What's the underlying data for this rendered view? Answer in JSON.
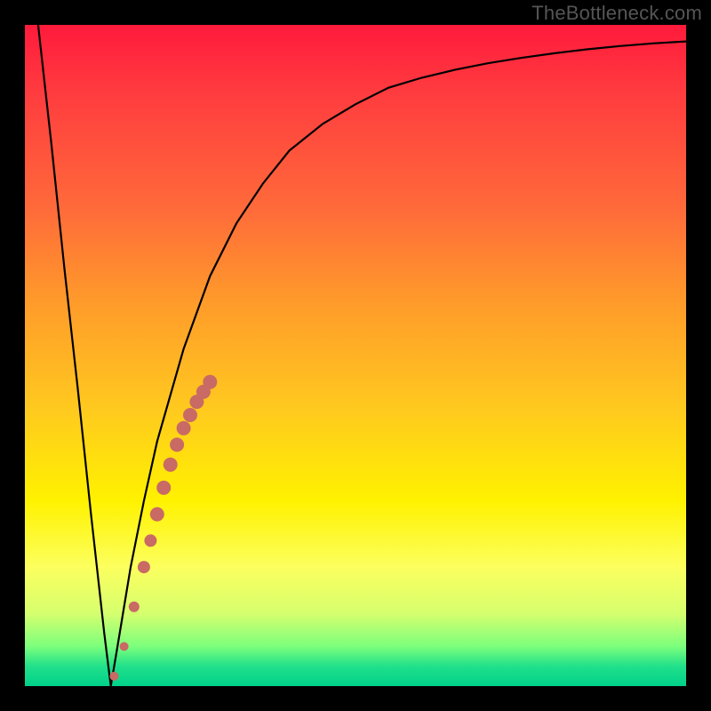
{
  "watermark": "TheBottleneck.com",
  "chart_data": {
    "type": "line",
    "title": "",
    "xlabel": "",
    "ylabel": "",
    "xlim": [
      0,
      100
    ],
    "ylim": [
      0,
      100
    ],
    "legend": false,
    "grid": false,
    "background_gradient": {
      "direction": "vertical",
      "stops": [
        {
          "pos": 0.0,
          "color": "#ff1a3c"
        },
        {
          "pos": 0.28,
          "color": "#ff6b3a"
        },
        {
          "pos": 0.58,
          "color": "#ffc91f"
        },
        {
          "pos": 0.82,
          "color": "#fcff5e"
        },
        {
          "pos": 0.97,
          "color": "#21e08a"
        },
        {
          "pos": 1.0,
          "color": "#00d18a"
        }
      ]
    },
    "series": [
      {
        "name": "bottleneck-curve",
        "type": "line",
        "color": "#000000",
        "x": [
          2,
          4,
          6,
          8,
          10,
          12,
          13,
          14,
          16,
          18,
          20,
          24,
          28,
          32,
          36,
          40,
          45,
          50,
          55,
          60,
          65,
          70,
          75,
          80,
          85,
          90,
          95,
          100
        ],
        "y": [
          100,
          82,
          63,
          45,
          26,
          8,
          0,
          6,
          18,
          28,
          37,
          51,
          62,
          70,
          76,
          81,
          85,
          88,
          90.5,
          92,
          93.2,
          94.2,
          95,
          95.7,
          96.3,
          96.8,
          97.2,
          97.5
        ]
      },
      {
        "name": "highlight-points",
        "type": "scatter",
        "color": "#c96a64",
        "x": [
          13.5,
          15.0,
          16.5,
          18.0,
          19.0,
          20.0,
          21.0,
          22.0,
          23.0,
          24.0,
          25.0,
          26.0,
          27.0,
          28.0
        ],
        "y": [
          1.5,
          6.0,
          12.0,
          18.0,
          22.0,
          26.0,
          30.0,
          33.5,
          36.5,
          39.0,
          41.0,
          43.0,
          44.5,
          46.0
        ],
        "r": [
          5,
          5,
          6,
          7,
          7,
          8,
          8,
          8,
          8,
          8,
          8,
          8,
          8,
          8
        ]
      }
    ]
  }
}
